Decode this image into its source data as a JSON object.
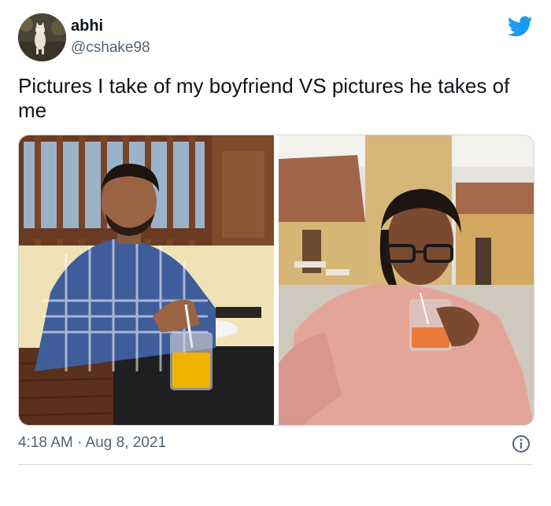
{
  "tweet": {
    "author_name": "abhi",
    "author_handle": "@cshake98",
    "text": "Pictures I take of my boyfriend VS pictures he takes of me",
    "timestamp": "4:18 AM · Aug 8, 2021"
  },
  "icons": {
    "logo": "twitter-bird-icon",
    "info": "info-icon"
  },
  "colors": {
    "brand": "#1d9bf0",
    "text_primary": "#0f1419",
    "text_secondary": "#536471",
    "border": "#cfd9de"
  }
}
